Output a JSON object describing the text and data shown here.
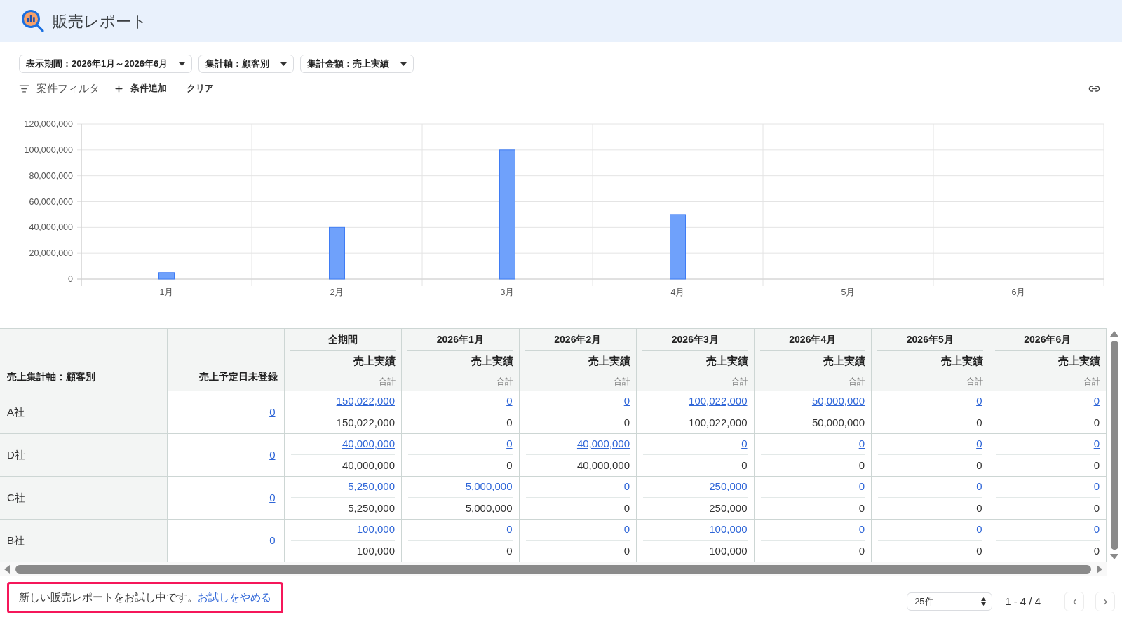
{
  "header": {
    "title": "販売レポート"
  },
  "filters": [
    {
      "label": "表示期間：2026年1月～2026年6月"
    },
    {
      "label": "集計軸：顧客別"
    },
    {
      "label": "集計金額：売上実績"
    }
  ],
  "filter_bar": {
    "filter": "案件フィルタ",
    "add": "条件追加",
    "clear": "クリア"
  },
  "chart": {
    "chart_data": {
      "type": "bar",
      "categories": [
        "1月",
        "2月",
        "3月",
        "4月",
        "5月",
        "6月"
      ],
      "values": [
        5000000,
        40000000,
        100000000,
        50000000,
        0,
        0
      ],
      "color": "#6fa1fb",
      "ylim": [
        0,
        120000000
      ],
      "yticks": [
        {
          "value": 0,
          "label": "0"
        },
        {
          "value": 20000000,
          "label": "20,000,000"
        },
        {
          "value": 40000000,
          "label": "40,000,000"
        },
        {
          "value": 60000000,
          "label": "60,000,000"
        },
        {
          "value": 80000000,
          "label": "80,000,000"
        },
        {
          "value": 100000000,
          "label": "100,000,000"
        },
        {
          "value": 120000000,
          "label": "120,000,000"
        }
      ],
      "grid": true
    }
  },
  "table": {
    "axis_heading": "売上集計軸：顧客別",
    "unscheduled_heading": "売上予定日未登録",
    "periods": [
      {
        "title": "全期間",
        "measure": "売上実績",
        "aggregate": "合計"
      },
      {
        "title": "2026年1月",
        "measure": "売上実績",
        "aggregate": "合計"
      },
      {
        "title": "2026年2月",
        "measure": "売上実績",
        "aggregate": "合計"
      },
      {
        "title": "2026年3月",
        "measure": "売上実績",
        "aggregate": "合計"
      },
      {
        "title": "2026年4月",
        "measure": "売上実績",
        "aggregate": "合計"
      },
      {
        "title": "2026年5月",
        "measure": "売上実績",
        "aggregate": "合計"
      },
      {
        "title": "2026年6月",
        "measure": "売上実績",
        "aggregate": "合計"
      }
    ],
    "rows": [
      {
        "name": "A社",
        "unscheduled": "0",
        "cells": [
          {
            "link": "150,022,000",
            "value": "150,022,000"
          },
          {
            "link": "0",
            "value": "0"
          },
          {
            "link": "0",
            "value": "0"
          },
          {
            "link": "100,022,000",
            "value": "100,022,000"
          },
          {
            "link": "50,000,000",
            "value": "50,000,000"
          },
          {
            "link": "0",
            "value": "0"
          },
          {
            "link": "0",
            "value": "0"
          }
        ]
      },
      {
        "name": "D社",
        "unscheduled": "0",
        "cells": [
          {
            "link": "40,000,000",
            "value": "40,000,000"
          },
          {
            "link": "0",
            "value": "0"
          },
          {
            "link": "40,000,000",
            "value": "40,000,000"
          },
          {
            "link": "0",
            "value": "0"
          },
          {
            "link": "0",
            "value": "0"
          },
          {
            "link": "0",
            "value": "0"
          },
          {
            "link": "0",
            "value": "0"
          }
        ]
      },
      {
        "name": "C社",
        "unscheduled": "0",
        "cells": [
          {
            "link": "5,250,000",
            "value": "5,250,000"
          },
          {
            "link": "5,000,000",
            "value": "5,000,000"
          },
          {
            "link": "0",
            "value": "0"
          },
          {
            "link": "250,000",
            "value": "250,000"
          },
          {
            "link": "0",
            "value": "0"
          },
          {
            "link": "0",
            "value": "0"
          },
          {
            "link": "0",
            "value": "0"
          }
        ]
      },
      {
        "name": "B社",
        "unscheduled": "0",
        "cells": [
          {
            "link": "100,000",
            "value": "100,000"
          },
          {
            "link": "0",
            "value": "0"
          },
          {
            "link": "0",
            "value": "0"
          },
          {
            "link": "100,000",
            "value": "100,000"
          },
          {
            "link": "0",
            "value": "0"
          },
          {
            "link": "0",
            "value": "0"
          },
          {
            "link": "0",
            "value": "0"
          }
        ]
      }
    ]
  },
  "notice": {
    "text": "新しい販売レポートをお試し中です。",
    "link": "お試しをやめる"
  },
  "pagination": {
    "page_size": "25件",
    "range": "1 - 4 / 4"
  }
}
